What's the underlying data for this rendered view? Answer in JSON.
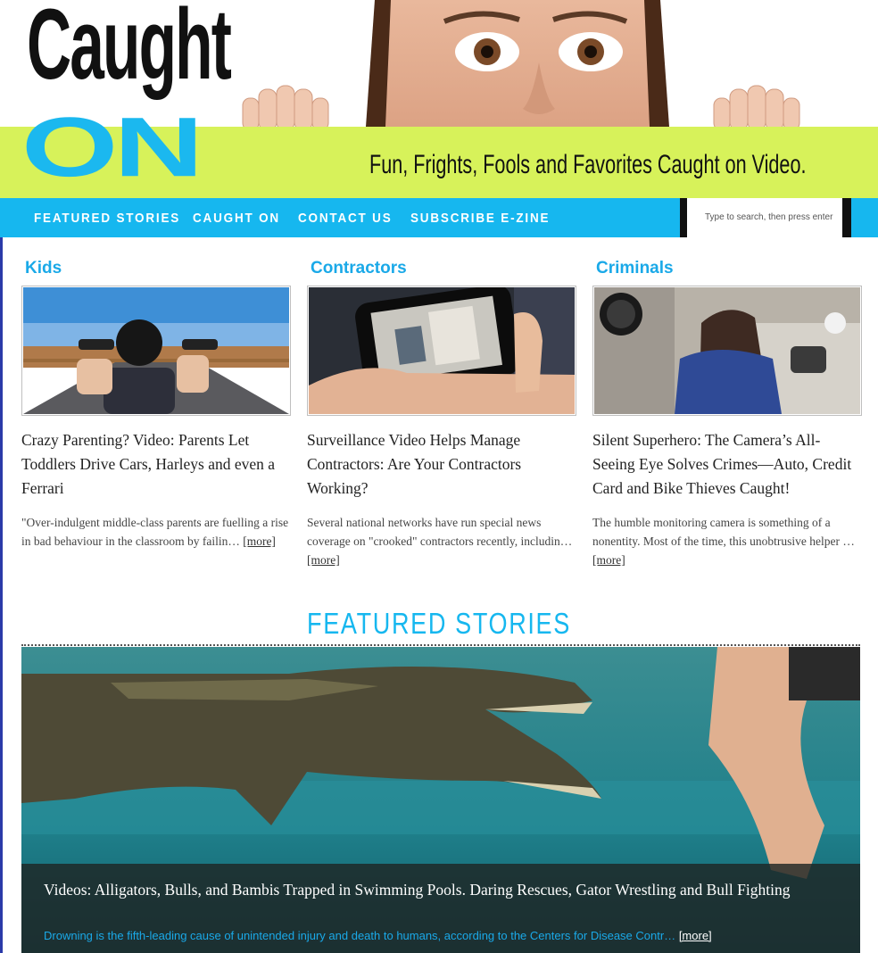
{
  "header": {
    "logo_line1": "Caught",
    "logo_line2": "ON",
    "tagline": "Fun, Frights, Fools and Favorites Caught on Video."
  },
  "nav": {
    "items": [
      "FEATURED STORIES",
      "CAUGHT ON",
      "CONTACT US",
      "SUBSCRIBE E-ZINE"
    ],
    "search_placeholder": "Type to search, then press enter"
  },
  "columns": [
    {
      "category": "Kids",
      "title": "Crazy Parenting? Video: Parents Let Toddlers Drive Cars, Harleys and even a Ferrari",
      "excerpt": "\"Over-indulgent middle-class parents are fuelling a rise in bad behaviour in the classroom by failin…",
      "more": "[more]"
    },
    {
      "category": "Contractors",
      "title": "Surveillance Video Helps Manage Contractors: Are Your Contractors Working?",
      "excerpt": "Several national networks have run special news coverage on \"crooked\" contractors recently, includin…",
      "more": "[more]"
    },
    {
      "category": "Criminals",
      "title": "Silent Superhero: The Camera’s All-Seeing Eye Solves Crimes—Auto, Credit Card and Bike Thieves Caught!",
      "excerpt": "The humble monitoring camera is something of a nonentity. Most of the time, this unobtrusive helper …",
      "more": "[more]"
    }
  ],
  "featured": {
    "heading": "FEATURED STORIES",
    "title": "Videos: Alligators, Bulls, and Bambis Trapped in Swimming Pools. Daring Rescues, Gator Wrestling and Bull Fighting",
    "excerpt": "Drowning is the fifth-leading cause of unintended injury and death to humans, according to the Centers for Disease Contr…",
    "more": "[more]"
  },
  "colors": {
    "accent_blue": "#16b7ef",
    "lime": "#d7f25a"
  }
}
